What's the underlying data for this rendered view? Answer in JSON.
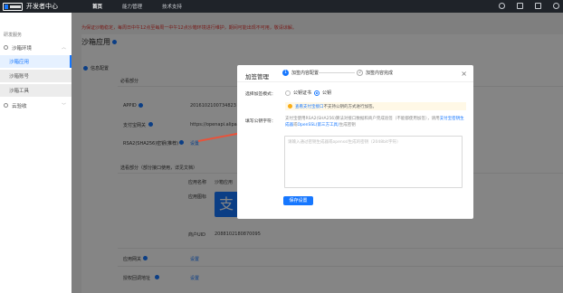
{
  "topbar": {
    "brand_logo_text": "支付宝",
    "brand": "开发者中心",
    "nav": [
      "首页",
      "能力管理",
      "技术支持"
    ]
  },
  "sidebar": {
    "section_title": "研发服务",
    "group1": "沙箱环境",
    "items": [
      "沙箱应用",
      "沙箱账号",
      "沙箱工具"
    ],
    "group2": "云验收"
  },
  "notice": "为保证沙箱稳定，每周日中午12点至每周一中午12点沙箱环境进行维护，期间可能出现不可用，敬请谅解。",
  "page": {
    "title": "沙箱应用",
    "section_info": "信息配置",
    "section_required": "必看部分",
    "appid_label": "APPID",
    "appid_value": "2016102100734823",
    "gateway_label": "支付宝网关",
    "gateway_value": "https://openapi.alipay",
    "rsa_label": "RSA2(SHA256)密钥(推荐)",
    "rsa_link": "设置",
    "section_optional": "选看部分（部分接口使用，详见文档）",
    "app_name_label": "应用名称",
    "app_name_value": "沙箱应用",
    "app_icon_label": "应用图标",
    "app_icon_glyph": "支",
    "merchant_label": "商户UID",
    "merchant_value": "2088102180870095",
    "gateway2_label": "应用网关",
    "gateway2_link": "设置",
    "callback_label": "授权回调地址",
    "callback_link": "设置"
  },
  "modal": {
    "title": "加签管理",
    "step1": "加签内容配置",
    "step2": "加签内容完成",
    "step1_num": "1",
    "step2_num": "2",
    "close_glyph": "×",
    "mode_label": "选择加签模式：",
    "radio1": "公钥证书",
    "radio2": "公钥",
    "tip_link": "查看支付宝接口",
    "tip_text": "不支持公钥的方式进行加签。",
    "key_label": "填写公钥字符：",
    "desc_prefix": "支付宝使用RSA2(SHA256)算法对接口数据和商户完成验签（不能都使用加签），请用",
    "desc_link1": "支付宝密钥生成器",
    "desc_or": "或",
    "desc_link2": "OpenSSL(第三方工具)",
    "desc_suffix": "生成密钥",
    "textarea_placeholder": "请输入通过密钥生成器或openssl生成的密钥（2048bit字符）",
    "save": "保存设置"
  },
  "colors": {
    "accent": "#1677ff",
    "notice": "#e53935",
    "topbar": "#1f2329",
    "arrow": "#e8533b"
  }
}
